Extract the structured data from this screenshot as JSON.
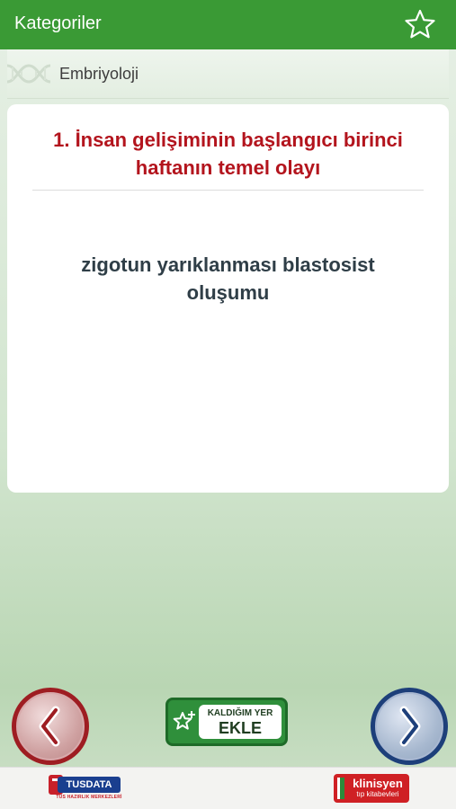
{
  "header": {
    "title": "Kategoriler",
    "favorite_icon": "star-outline-icon"
  },
  "category": {
    "label": "Embriyoloji",
    "decoration_icon": "dna-icon"
  },
  "card": {
    "question": "1. İnsan gelişiminin başlangıcı birinci haftanın temel olayı",
    "answer": "zigotun yarıklanması blastosist oluşumu"
  },
  "navigation": {
    "prev_icon": "chevron-left-icon",
    "next_icon": "chevron-right-icon"
  },
  "bookmark": {
    "icon": "star-plus-icon",
    "line1": "KALDIĞIM YER",
    "line2": "EKLE"
  },
  "footer": {
    "left_logo": {
      "name": "TUSDATA",
      "tagline": "TUS HAZIRLIK MERKEZLERİ"
    },
    "right_logo": {
      "name": "klinisyen",
      "subtitle": "tıp kitabevleri"
    }
  },
  "colors": {
    "header_green": "#3a9a35",
    "question_red": "#b3141d",
    "answer_slate": "#2f3e47",
    "prev_ring": "#9e1d22",
    "next_ring": "#1d3f7a",
    "bookmark_green": "#2f8f3b"
  }
}
